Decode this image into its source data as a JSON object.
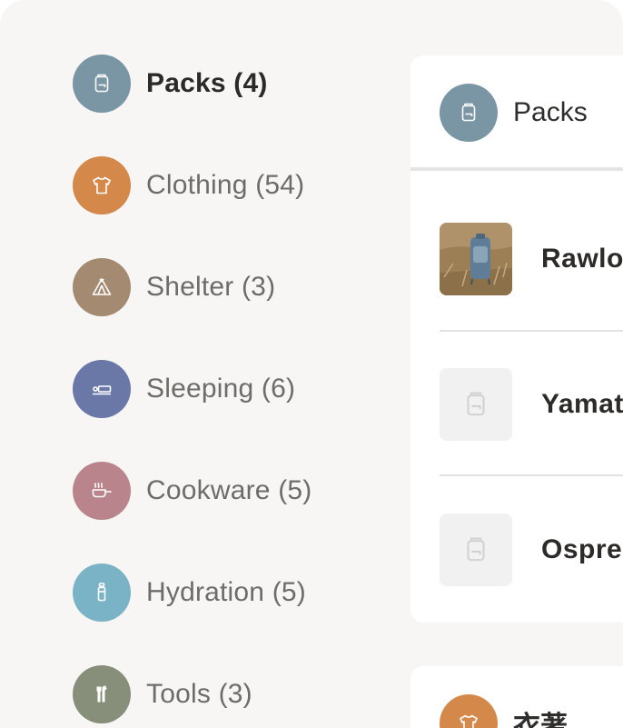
{
  "sidebar": {
    "items": [
      {
        "label": "Packs (4)",
        "icon": "backpack-icon",
        "color": "#7a95a3",
        "active": true
      },
      {
        "label": "Clothing (54)",
        "icon": "tshirt-icon",
        "color": "#d4884a"
      },
      {
        "label": "Shelter (3)",
        "icon": "tent-icon",
        "color": "#a48a70"
      },
      {
        "label": "Sleeping (6)",
        "icon": "sleeping-pad-icon",
        "color": "#6a78a8"
      },
      {
        "label": "Cookware (5)",
        "icon": "pan-icon",
        "color": "#b9848b"
      },
      {
        "label": "Hydration (5)",
        "icon": "bottle-icon",
        "color": "#7ab2c6"
      },
      {
        "label": "Tools (3)",
        "icon": "multitool-icon",
        "color": "#878f7a"
      }
    ]
  },
  "main": {
    "title": "Packs",
    "icon": "backpack-icon",
    "items": [
      {
        "name": "Rawlo",
        "thumb": "photo"
      },
      {
        "name": "Yamat",
        "thumb": "placeholder"
      },
      {
        "name": "Ospre",
        "thumb": "placeholder"
      }
    ]
  },
  "next_section": {
    "title": "衣著",
    "icon": "tshirt-icon",
    "color": "#d4884a"
  }
}
